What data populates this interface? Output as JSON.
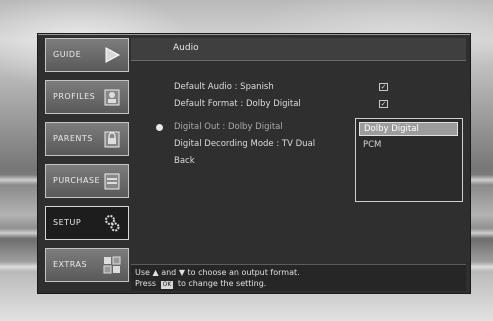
{
  "tabs": [
    {
      "label": "GUIDE",
      "icon": "arrow-right-icon"
    },
    {
      "label": "PROFILES",
      "icon": "profile-card-icon"
    },
    {
      "label": "PARENTS",
      "icon": "lock-card-icon"
    },
    {
      "label": "PURCHASE",
      "icon": "purchase-card-icon"
    },
    {
      "label": "SETUP",
      "icon": "settings-gears-icon"
    },
    {
      "label": "EXTRAS",
      "icon": "extras-grid-icon"
    }
  ],
  "active_tab": "SETUP",
  "header": {
    "title": "Audio"
  },
  "settings": [
    {
      "label": "Default Audio : Spanish",
      "checked": true
    },
    {
      "label": "Default Format : Dolby Digital",
      "checked": true
    },
    {
      "label": "Digital Out : Dolby Digital"
    },
    {
      "label": "Digital Decording Mode : TV Dual"
    },
    {
      "label": "Back"
    }
  ],
  "dropdown": {
    "options": [
      "Dolby Digital",
      "PCM"
    ],
    "selected": "Dolby Digital"
  },
  "footer": {
    "line1_prefix": "Use",
    "line1_and": "and",
    "line1_suffix": "to choose an output format.",
    "line2_prefix": "Press",
    "line2_key": "OK",
    "line2_suffix": "to change the setting."
  },
  "colors": {
    "panel": "#2f2f2f",
    "tab": "#6b6b6b",
    "highlight": "#9c9c9c"
  }
}
